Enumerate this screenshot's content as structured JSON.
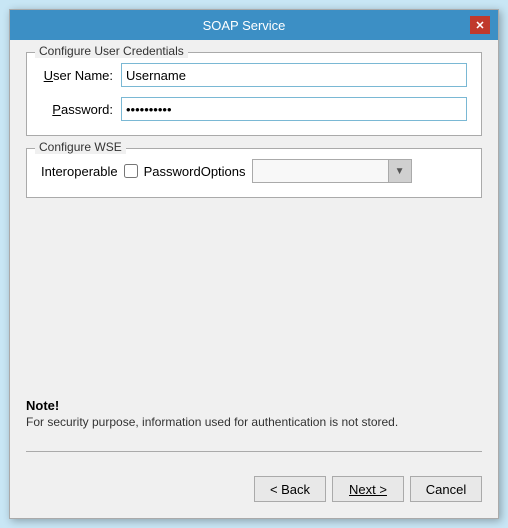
{
  "window": {
    "title": "SOAP Service",
    "close_label": "✕"
  },
  "credentials_group": {
    "legend": "Configure User Credentials",
    "username_label": "User Name:",
    "username_underline": "U",
    "username_value": "Username",
    "password_label": "Password:",
    "password_underline": "P",
    "password_value": "••••••••••"
  },
  "wse_group": {
    "legend": "Configure WSE",
    "interoperable_label": "Interoperable",
    "password_options_label": "PasswordOptions",
    "dropdown_arrow": "▼"
  },
  "note": {
    "title": "Note!",
    "text": "For security purpose, information used for authentication is not stored."
  },
  "buttons": {
    "back_label": "< Back",
    "next_label": "Next >",
    "cancel_label": "Cancel"
  }
}
